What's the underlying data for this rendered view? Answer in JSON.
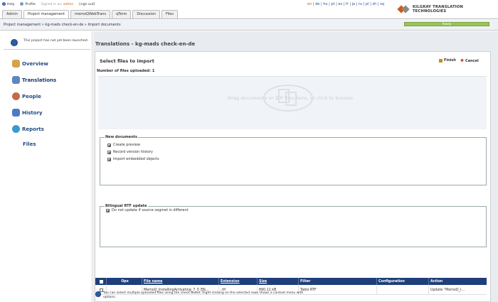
{
  "util": {
    "help": "Help",
    "profile": "Profile",
    "signed_as": "Signed in as:",
    "user": "admin",
    "signout": "[sign out]"
  },
  "tabs": [
    "Admin",
    "Project management",
    "memoQWebTrans",
    "qTerm",
    "Discussion",
    "Files"
  ],
  "languages": {
    "current": "en",
    "others": "| de | hu | pt | es | fr | ja | ru | pl | zh | sq"
  },
  "logo": {
    "text": "KILGRAY TRANSLATION TECHNOLOGIES"
  },
  "breadcrumb": "Project management  » kg-mads check-en-de  » Import documents",
  "status": "Ready",
  "sidebar": {
    "notice": "This project has not yet been launched.",
    "items": [
      "Overview",
      "Translations",
      "People",
      "History",
      "Reports",
      "Files"
    ]
  },
  "main": {
    "title": "Translations - kg-mads check-en-de",
    "heading": "Select files to import",
    "finish": "Finish",
    "cancel": "Cancel",
    "uploaded": "Number of files uploaded: 1",
    "drop_text": "Drag documents or ZIP files here, or click to browse",
    "new_docs": {
      "legend": "New documents",
      "options": [
        {
          "label": "Create preview",
          "checked": true
        },
        {
          "label": "Record version history",
          "checked": true
        },
        {
          "label": "Import embedded objects",
          "checked": true
        }
      ]
    },
    "bilingual": {
      "legend": "Bilingual RTF update",
      "option": "Do not update if source segmet is different",
      "checked": true
    },
    "table": {
      "headers": [
        "",
        "Ops",
        "File name",
        "Extension",
        "Size",
        "Filter",
        "Configuration",
        "Action"
      ],
      "rows": [
        [
          "",
          "",
          "MemoQ_InstallingActivating_7_0_EN...",
          ".rtf",
          "890.11 kB",
          "Table RTF",
          "",
          "Update \"MemoQ_I..."
        ]
      ]
    },
    "footnote": "You can select multiple uploaded files using the check boxes. Right-clicking on the selected rows shows a context menu with options."
  },
  "colors": {
    "header_blue": "#1f3f7a",
    "accent_orange": "#d05a10",
    "ready_green": "#9bc25a"
  }
}
